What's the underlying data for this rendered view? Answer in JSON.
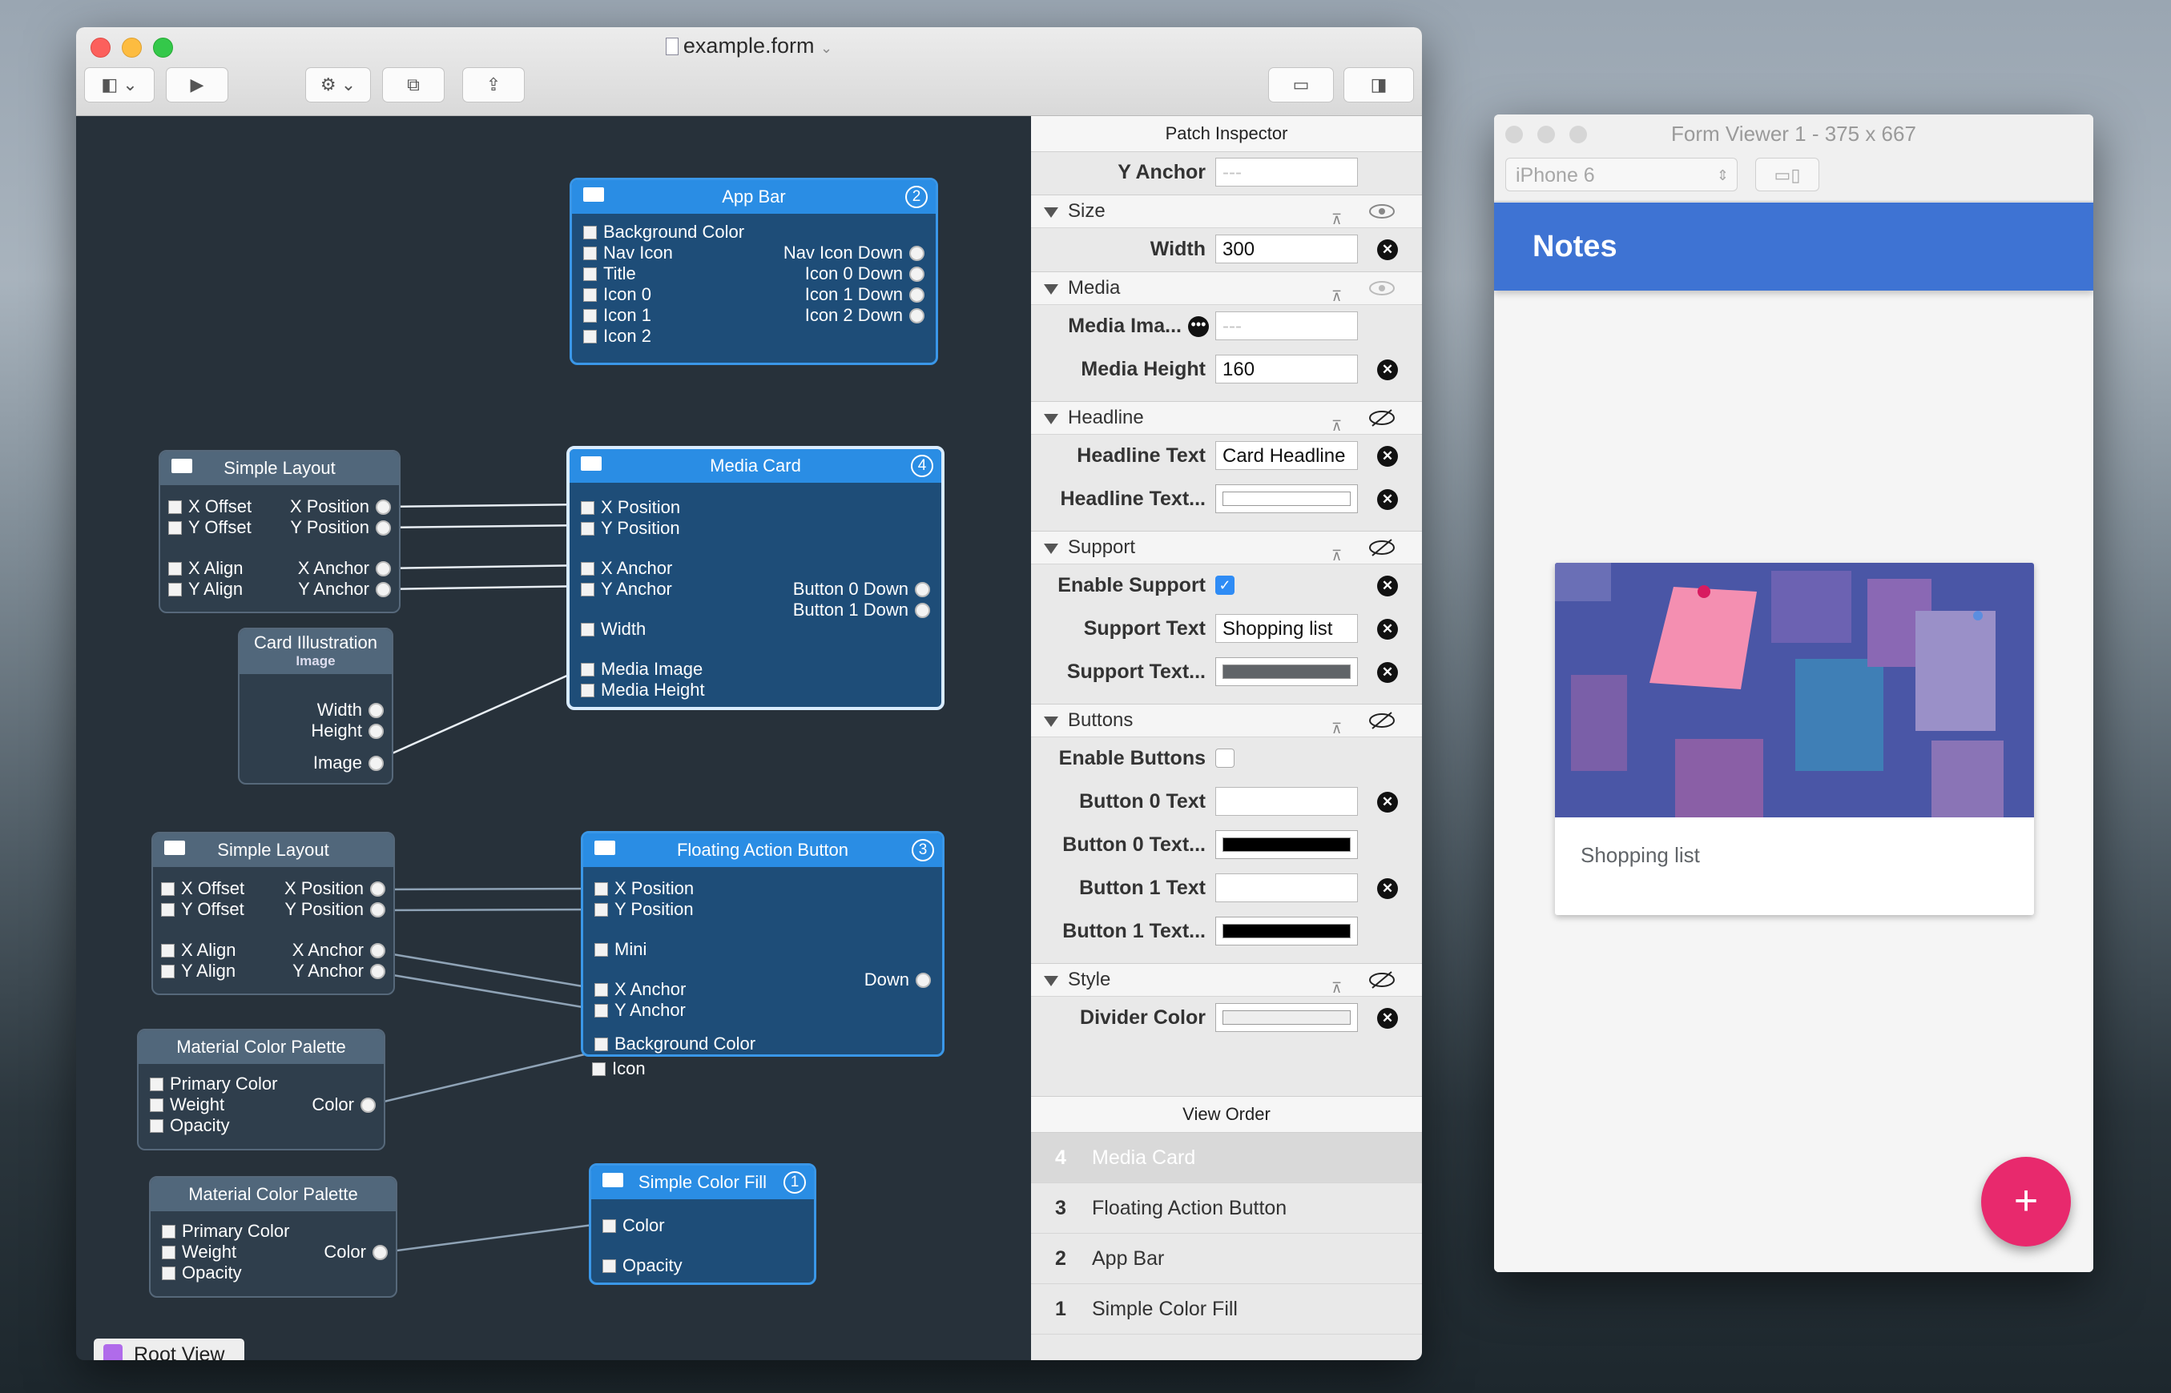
{
  "main_window": {
    "title": "example.form",
    "toolbar": {
      "sidebar_icon": "sidebar-icon",
      "preview_icon": "play-icon",
      "settings_icon": "gear-icon",
      "duplicate_icon": "duplicate-icon",
      "share_icon": "share-icon",
      "layout_icon": "window-layout-icon",
      "inspector_icon": "inspector-toggle-icon"
    }
  },
  "canvas": {
    "root_view_label": "Root View",
    "nodes": {
      "app_bar": {
        "title": "App Bar",
        "badge": "2",
        "inputs": [
          "Background Color",
          "Nav Icon",
          "Title",
          "Icon 0",
          "Icon 1",
          "Icon 2"
        ],
        "outputs": [
          "Nav Icon Down",
          "Icon 0 Down",
          "Icon 1 Down",
          "Icon 2 Down"
        ]
      },
      "simple_layout_1": {
        "title": "Simple Layout",
        "inputs": [
          "X Offset",
          "Y Offset",
          "X Align",
          "Y Align"
        ],
        "outputs": [
          "X Position",
          "Y Position",
          "X Anchor",
          "Y Anchor"
        ]
      },
      "media_card": {
        "title": "Media Card",
        "badge": "4",
        "inputs": [
          "X Position",
          "Y Position",
          "X Anchor",
          "Y Anchor",
          "Width",
          "Media Image",
          "Media Height"
        ],
        "outputs": [
          "Button 0 Down",
          "Button 1 Down"
        ]
      },
      "card_illustration": {
        "title": "Card Illustration",
        "subtitle": "Image",
        "outputs": [
          "Width",
          "Height",
          "Image"
        ]
      },
      "simple_layout_2": {
        "title": "Simple Layout",
        "inputs": [
          "X Offset",
          "Y Offset",
          "X Align",
          "Y Align"
        ],
        "outputs": [
          "X Position",
          "Y Position",
          "X Anchor",
          "Y Anchor"
        ]
      },
      "fab": {
        "title": "Floating Action Button",
        "badge": "3",
        "inputs": [
          "X Position",
          "Y Position",
          "Mini",
          "X Anchor",
          "Y Anchor",
          "Background Color",
          "Icon"
        ],
        "outputs": [
          "Down"
        ]
      },
      "palette_1": {
        "title": "Material Color Palette",
        "inputs": [
          "Primary Color",
          "Weight",
          "Opacity"
        ],
        "outputs": [
          "Color"
        ]
      },
      "palette_2": {
        "title": "Material Color Palette",
        "inputs": [
          "Primary Color",
          "Weight",
          "Opacity"
        ],
        "outputs": [
          "Color"
        ]
      },
      "color_fill": {
        "title": "Simple Color Fill",
        "badge": "1",
        "inputs": [
          "Color",
          "Opacity"
        ]
      }
    }
  },
  "inspector": {
    "title": "Patch Inspector",
    "y_anchor": {
      "label": "Y Anchor",
      "placeholder": "---"
    },
    "sections": {
      "size": "Size",
      "media": "Media",
      "headline": "Headline",
      "support": "Support",
      "buttons": "Buttons",
      "style": "Style"
    },
    "fields": {
      "width": {
        "label": "Width",
        "value": "300"
      },
      "media_image": {
        "label": "Media Ima...",
        "placeholder": "---"
      },
      "media_height": {
        "label": "Media Height",
        "value": "160"
      },
      "headline_text": {
        "label": "Headline Text",
        "value": "Card Headline"
      },
      "headline_text_color": {
        "label": "Headline Text...",
        "color": "#ffffff"
      },
      "enable_support": {
        "label": "Enable Support",
        "checked": true
      },
      "support_text": {
        "label": "Support Text",
        "value": "Shopping list"
      },
      "support_text_color": {
        "label": "Support Text...",
        "color": "#606468"
      },
      "enable_buttons": {
        "label": "Enable Buttons",
        "checked": false
      },
      "button0_text": {
        "label": "Button 0 Text",
        "value": ""
      },
      "button0_text_color": {
        "label": "Button 0 Text...",
        "color": "#000000"
      },
      "button1_text": {
        "label": "Button 1 Text",
        "value": ""
      },
      "button1_text_color": {
        "label": "Button 1 Text...",
        "color": "#000000"
      },
      "divider_color": {
        "label": "Divider Color",
        "color": "#eeeeee"
      }
    },
    "view_order_title": "View Order",
    "view_order": [
      {
        "num": "4",
        "name": "Media Card",
        "selected": true
      },
      {
        "num": "3",
        "name": "Floating Action Button",
        "selected": false
      },
      {
        "num": "2",
        "name": "App Bar",
        "selected": false
      },
      {
        "num": "1",
        "name": "Simple Color Fill",
        "selected": false
      }
    ]
  },
  "viewer": {
    "title": "Form Viewer 1 - 375 x 667",
    "device": "iPhone 6",
    "app_bar_title": "Notes",
    "card_support_text": "Shopping list",
    "fab_label": "+"
  },
  "colors": {
    "accent_blue": "#2a8de4",
    "app_bar": "#3e73d3",
    "fab": "#e8296d"
  }
}
